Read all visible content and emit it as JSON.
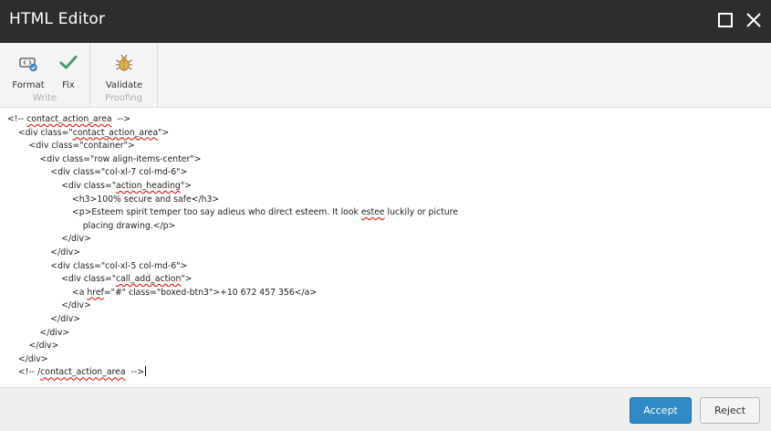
{
  "window": {
    "title": "HTML Editor",
    "maximize_icon": "maximize-icon",
    "close_icon": "close-icon"
  },
  "ribbon": {
    "groups": [
      {
        "label": "Write",
        "buttons": [
          {
            "label": "Format",
            "icon": "format-icon"
          },
          {
            "label": "Fix",
            "icon": "checkmark-icon"
          }
        ]
      },
      {
        "label": "Proofing",
        "buttons": [
          {
            "label": "Validate",
            "icon": "bug-icon"
          }
        ]
      }
    ]
  },
  "editor": {
    "lines": [
      [
        {
          "t": "<!-- "
        },
        {
          "t": "contact_action_area",
          "sp": true
        },
        {
          "t": "  -->"
        }
      ],
      [
        {
          "t": "    <div class=\""
        },
        {
          "t": "contact_action_area",
          "sp": true
        },
        {
          "t": "\">"
        }
      ],
      [
        {
          "t": "        <div class=\"container\">"
        }
      ],
      [
        {
          "t": "            <div class=\"row align-items-center\">"
        }
      ],
      [
        {
          "t": "                <div class=\"col-xl-7 col-md-6\">"
        }
      ],
      [
        {
          "t": "                    <div class=\""
        },
        {
          "t": "action_heading",
          "sp": true
        },
        {
          "t": "\">"
        }
      ],
      [
        {
          "t": "                        <h3>100% secure and safe</h3>"
        }
      ],
      [
        {
          "t": "                        <p>Esteem spirit temper too say adieus who direct esteem. It look "
        },
        {
          "t": "estee",
          "sp": true
        },
        {
          "t": " luckily or picture"
        }
      ],
      [
        {
          "t": "                            placing drawing.</p>"
        }
      ],
      [
        {
          "t": "                    </div>"
        }
      ],
      [
        {
          "t": "                </div>"
        }
      ],
      [
        {
          "t": "                <div class=\"col-xl-5 col-md-6\">"
        }
      ],
      [
        {
          "t": "                    <div class=\""
        },
        {
          "t": "call_add_action",
          "sp": true
        },
        {
          "t": "\">"
        }
      ],
      [
        {
          "t": "                        <a "
        },
        {
          "t": "href",
          "sp": true
        },
        {
          "t": "=\"#\" class=\"boxed-btn3\">+10 672 457 356</a>"
        }
      ],
      [
        {
          "t": "                    </div>"
        }
      ],
      [
        {
          "t": "                </div>"
        }
      ],
      [
        {
          "t": "            </div>"
        }
      ],
      [
        {
          "t": "        </div>"
        }
      ],
      [
        {
          "t": "    </div>"
        }
      ],
      [
        {
          "t": "    <!-- /"
        },
        {
          "t": "contact_action_area",
          "sp": true
        },
        {
          "t": "  -->"
        }
      ]
    ]
  },
  "footer": {
    "accept_label": "Accept",
    "reject_label": "Reject"
  },
  "colors": {
    "titlebar": "#2d2d2d",
    "accent": "#2f8ac6",
    "spellcheck": "#d40000"
  }
}
